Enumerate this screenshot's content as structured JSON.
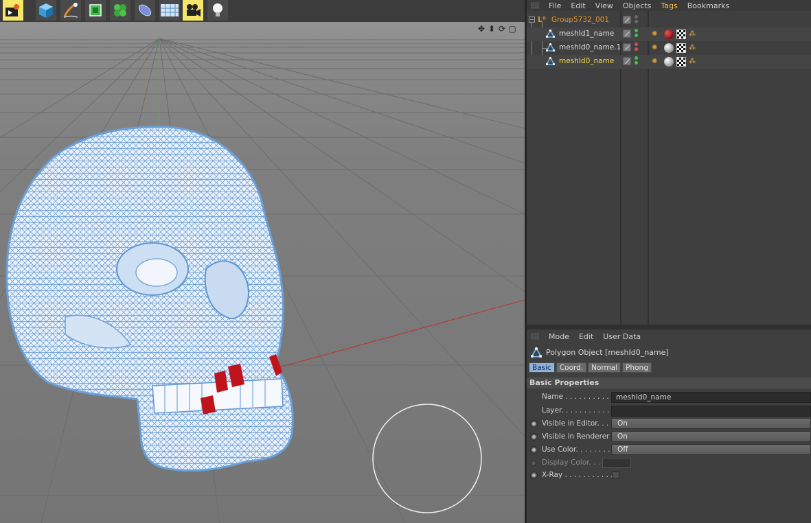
{
  "menus": {
    "object_manager": [
      "File",
      "Edit",
      "View",
      "Objects",
      "Tags",
      "Bookmarks"
    ],
    "object_manager_active": "Tags",
    "attribute_manager": [
      "Mode",
      "Edit",
      "User Data"
    ]
  },
  "objects": [
    {
      "name": "Group5732_001",
      "style": "orange",
      "type": "null"
    },
    {
      "name": "meshId1_name",
      "style": "normal",
      "type": "polygon",
      "material": "red"
    },
    {
      "name": "meshId0_name.1",
      "style": "normal",
      "type": "polygon",
      "material": "white"
    },
    {
      "name": "meshId0_name",
      "style": "selected",
      "type": "polygon",
      "material": "white"
    }
  ],
  "attributes": {
    "title": "Polygon Object [meshId0_name]",
    "tabs": [
      "Basic",
      "Coord.",
      "Normal",
      "Phong"
    ],
    "active_tab": "Basic",
    "section": "Basic Properties",
    "props": {
      "name_label": "Name . . . . . . . . . . . .",
      "name_value": "meshId0_name",
      "layer_label": "Layer. . . . . . . . . . . .",
      "vis_editor_label": "Visible in Editor. . .",
      "vis_editor_value": "On",
      "vis_render_label": "Visible in Renderer",
      "vis_render_value": "On",
      "use_color_label": "Use Color. . . . . . . .",
      "use_color_value": "Off",
      "display_color_label": "Display Color. . .",
      "xray_label": "X-Ray . . . . . . . . . . ."
    }
  },
  "icons": {
    "toolbar": [
      "render-settings-icon",
      "cube-icon",
      "pen-icon",
      "subdivision-icon",
      "cloner-icon",
      "deformer-icon",
      "floor-icon",
      "camera-icon",
      "light-icon"
    ],
    "viewport_nav": [
      "move-view-icon",
      "zoom-view-icon",
      "rotate-view-icon",
      "maximize-view-icon"
    ]
  },
  "colors": {
    "wireframe": "#6a9fd8",
    "teeth": "#c0141c",
    "selected_object": "#f4d84a",
    "group_object": "#e0942c"
  }
}
